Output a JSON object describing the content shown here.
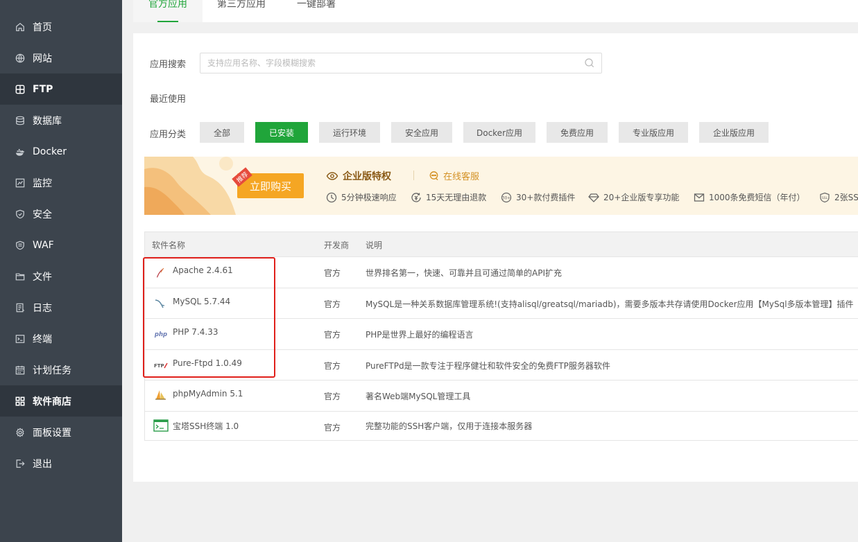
{
  "sidebar": {
    "items": [
      {
        "label": "首页",
        "icon": "home-icon"
      },
      {
        "label": "网站",
        "icon": "globe-icon"
      },
      {
        "label": "FTP",
        "icon": "ftp-globe-icon"
      },
      {
        "label": "数据库",
        "icon": "database-icon"
      },
      {
        "label": "Docker",
        "icon": "docker-icon"
      },
      {
        "label": "监控",
        "icon": "monitor-icon"
      },
      {
        "label": "安全",
        "icon": "shield-icon"
      },
      {
        "label": "WAF",
        "icon": "waf-shield-icon"
      },
      {
        "label": "文件",
        "icon": "folder-icon"
      },
      {
        "label": "日志",
        "icon": "log-icon"
      },
      {
        "label": "终端",
        "icon": "terminal-icon"
      },
      {
        "label": "计划任务",
        "icon": "calendar-icon"
      },
      {
        "label": "软件商店",
        "icon": "grid-icon"
      },
      {
        "label": "面板设置",
        "icon": "gear-icon"
      },
      {
        "label": "退出",
        "icon": "logout-icon"
      }
    ],
    "active_index": 12
  },
  "tabs": [
    {
      "label": "官方应用"
    },
    {
      "label": "第三方应用"
    },
    {
      "label": "一键部署"
    }
  ],
  "search": {
    "label": "应用搜索",
    "placeholder": "支持应用名称、字段模糊搜索",
    "value": ""
  },
  "recent": {
    "label": "最近使用"
  },
  "category": {
    "label": "应用分类",
    "items": [
      "全部",
      "已安装",
      "运行环境",
      "安全应用",
      "Docker应用",
      "免费应用",
      "专业版应用",
      "企业版应用"
    ],
    "active_index": 1
  },
  "banner": {
    "buy_label": "立即购买",
    "tag": "推荐",
    "title": "企业版特权",
    "service": "在线客服",
    "features": [
      {
        "label": "5分钟极速响应",
        "icon": "clock-icon"
      },
      {
        "label": "15天无理由退款",
        "icon": "refund-icon"
      },
      {
        "label": "30+款付费插件",
        "icon": "plugin-icon"
      },
      {
        "label": "20+企业版专享功能",
        "icon": "diamond-icon"
      },
      {
        "label": "1000条免费短信（年付）",
        "icon": "mail-icon"
      },
      {
        "label": "2张SS",
        "icon": "ssl-icon"
      }
    ]
  },
  "table": {
    "headers": [
      "软件名称",
      "开发商",
      "说明"
    ],
    "rows": [
      {
        "name": "Apache 2.4.61",
        "vendor": "官方",
        "desc": "世界排名第一，快速、可靠并且可通过简单的API扩充",
        "icon": "apache-feather-icon"
      },
      {
        "name": "MySQL 5.7.44",
        "vendor": "官方",
        "desc": "MySQL是一种关系数据库管理系统!(支持alisql/greatsql/mariadb)，需要多版本共存请使用Docker应用【MySql多版本管理】插件",
        "icon": "mysql-dolphin-icon"
      },
      {
        "name": "PHP 7.4.33",
        "vendor": "官方",
        "desc": "PHP是世界上最好的编程语言",
        "icon": "php-logo-icon"
      },
      {
        "name": "Pure-Ftpd 1.0.49",
        "vendor": "官方",
        "desc": "PureFTPd是一款专注于程序健壮和软件安全的免费FTP服务器软件",
        "icon": "ftpd-logo-icon"
      },
      {
        "name": "phpMyAdmin 5.1",
        "vendor": "官方",
        "desc": "著名Web端MySQL管理工具",
        "icon": "phpmyadmin-sail-icon"
      },
      {
        "name": "宝塔SSH终端 1.0",
        "vendor": "官方",
        "desc": "完整功能的SSH客户端，仅用于连接本服务器",
        "icon": "ssh-terminal-icon"
      }
    ]
  },
  "colors": {
    "accent": "#20a53a",
    "sidebar_bg": "#3c444d",
    "highlight_box": "#e0201b",
    "buy_button": "#f5a623"
  }
}
